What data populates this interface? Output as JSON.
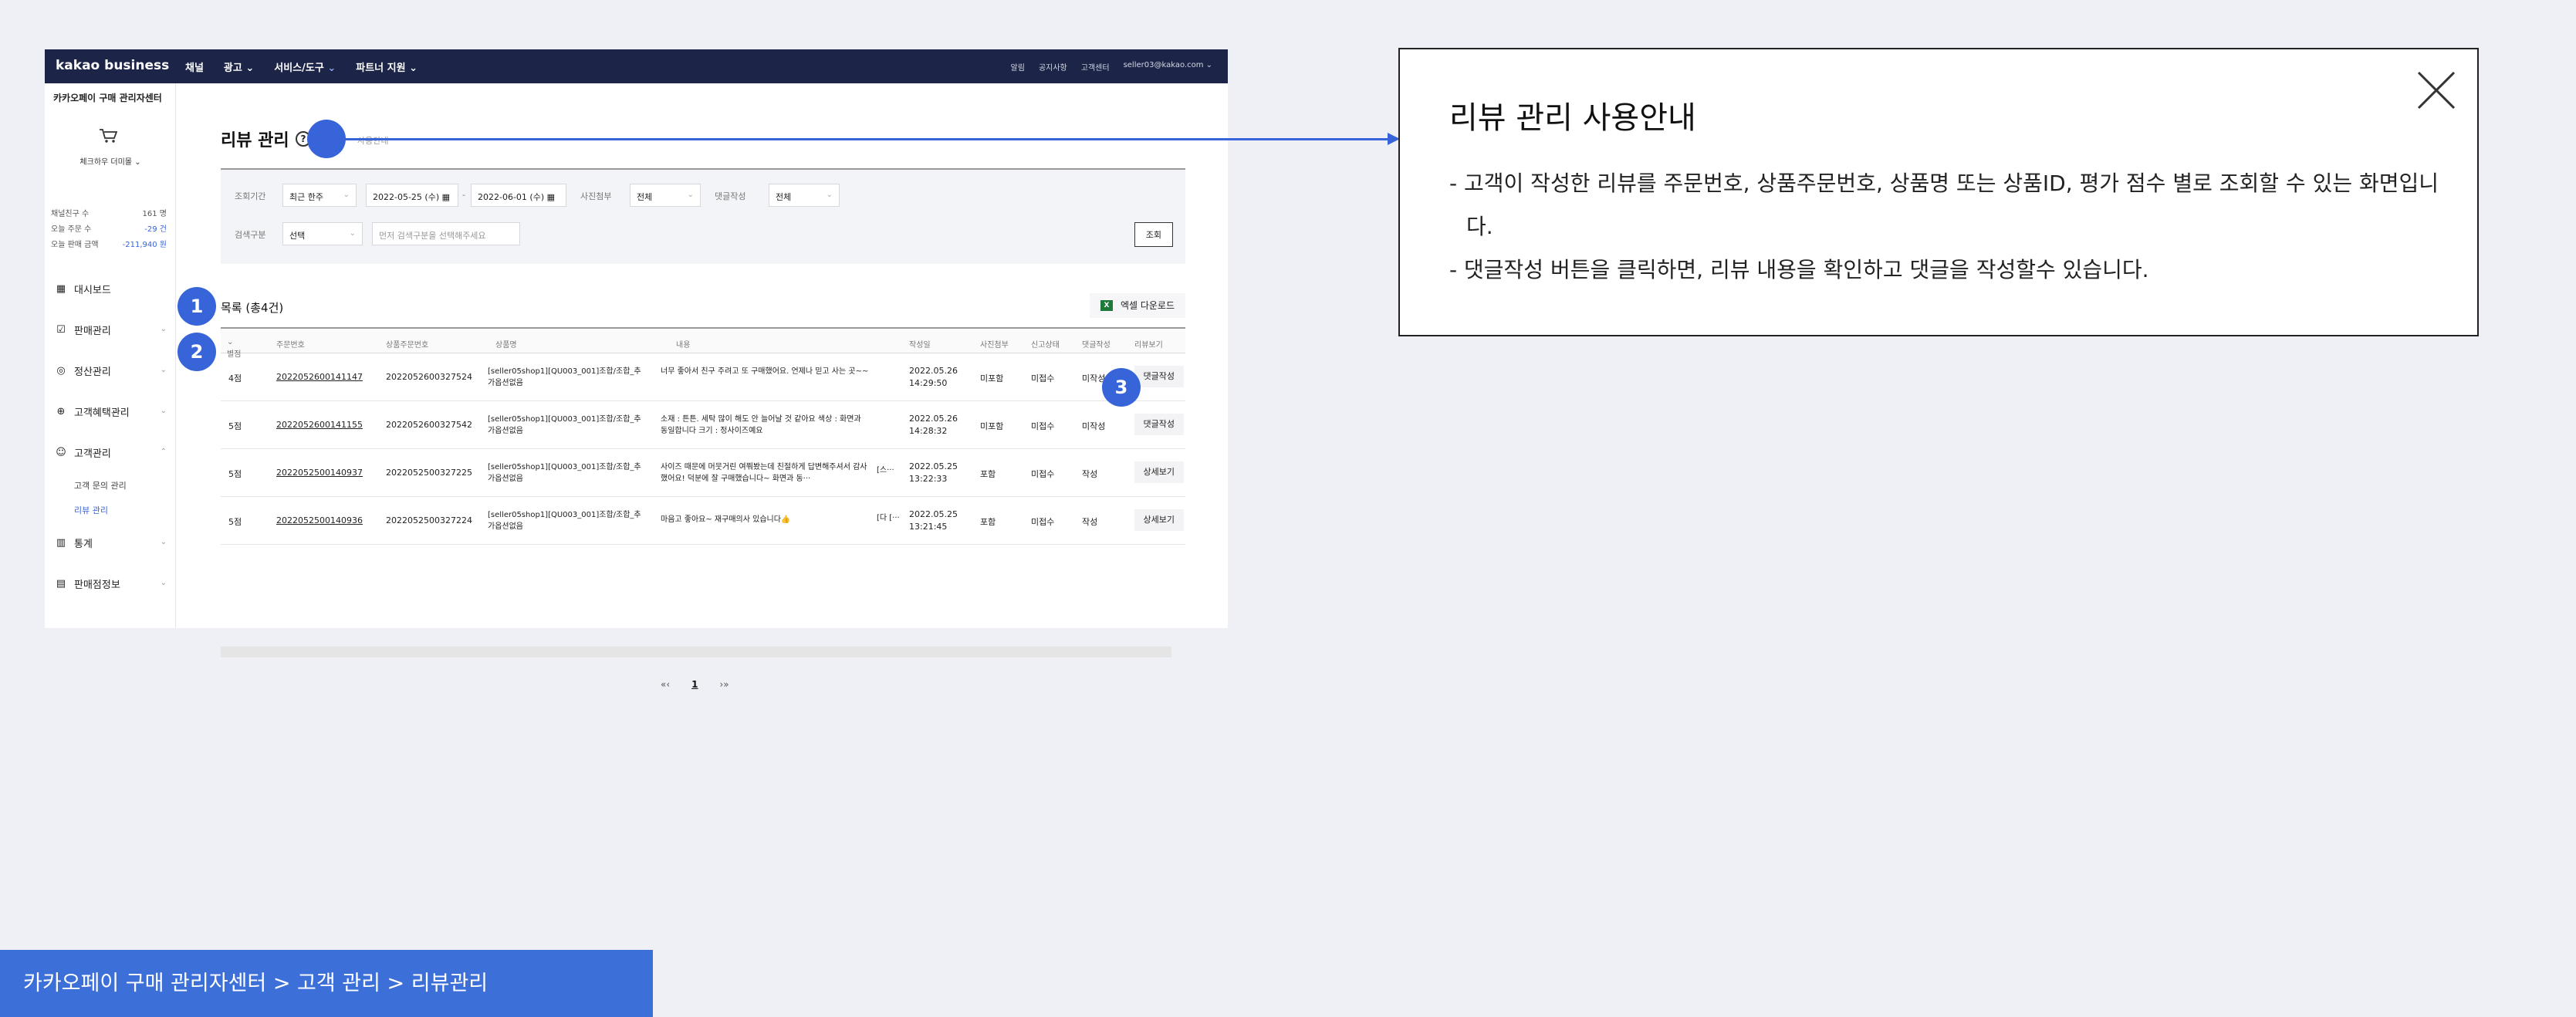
{
  "app": {
    "brand": "kakao business",
    "nav": [
      "채널",
      "광고",
      "서비스/도구",
      "파트너 지원"
    ],
    "util": [
      "알림",
      "공지사항",
      "고객센터",
      "seller03@kakao.com"
    ]
  },
  "sidebar": {
    "title": "카카오페이 구매 관리자센터",
    "store": "체크하우 더미몰",
    "stats": [
      {
        "label": "채널친구 수",
        "value": "161 명"
      },
      {
        "label": "오늘 주문 수",
        "value": "-29 건"
      },
      {
        "label": "오늘 판매 금액",
        "value": "-211,940 원"
      }
    ],
    "menu": [
      {
        "label": "대시보드"
      },
      {
        "label": "판매관리"
      },
      {
        "label": "정산관리"
      },
      {
        "label": "고객혜택관리"
      },
      {
        "label": "고객관리"
      },
      {
        "label": "통계"
      },
      {
        "label": "판매점정보"
      }
    ],
    "submenu": [
      "고객 문의 관리",
      "리뷰 관리"
    ]
  },
  "main": {
    "title": "리뷰 관리",
    "guide_link": "사용안내",
    "filter": {
      "period_label": "조회기간",
      "period_value": "최근 한주",
      "date_from": "2022-05-25 (수)",
      "date_sep": "-",
      "date_to": "2022-06-01 (수)",
      "photo_label": "사진첨부",
      "photo_value": "전체",
      "reply_label": "댓글작성",
      "reply_value": "전체",
      "search_label": "검색구분",
      "search_value": "선택",
      "search_placeholder": "먼저 검색구분을 선택해주세요",
      "search_button": "조회"
    },
    "list_title": "목록 (총4건)",
    "excel_label": "엑셀 다운로드",
    "columns": [
      "별점",
      "주문번호",
      "상품주문번호",
      "상품명",
      "내용",
      "작성일",
      "사진첨부",
      "신고상태",
      "댓글작성",
      "리뷰보기"
    ],
    "rows": [
      {
        "rating": "4점",
        "order": "2022052600141147",
        "item_order": "2022052600327524",
        "product": "[seller05shop1][QU003_001]조합/조합_추가옵션없음",
        "content": "너무 좋아서 친구 주려고 또 구매했어요. 언제나 믿고 사는 곳~~",
        "extra": "",
        "date": "2022.05.26",
        "time": "14:29:50",
        "photo": "미포함",
        "report": "미접수",
        "reply": "미작성",
        "action": "댓글작성"
      },
      {
        "rating": "5점",
        "order": "2022052600141155",
        "item_order": "2022052600327542",
        "product": "[seller05shop1][QU003_001]조합/조합_추가옵션없음",
        "content": "소재 : 튼튼. 세탁 많이 해도 안 늘어날 것 같아요 색상 : 화면과 동일합니다 크기 : 정사이즈예요",
        "extra": "",
        "date": "2022.05.26",
        "time": "14:28:32",
        "photo": "미포함",
        "report": "미접수",
        "reply": "미작성",
        "action": "댓글작성"
      },
      {
        "rating": "5점",
        "order": "2022052500140937",
        "item_order": "2022052500327225",
        "product": "[seller05shop1][QU003_001]조합/조합_추가옵션없음",
        "content": "사이즈 때문에 머뭇거린 여쭤봤는데 친절하게 답변해주셔서 감사했어요! 덕분에 잘 구매했습니다~ 화면과 동···",
        "extra": "[스···",
        "date": "2022.05.25",
        "time": "13:22:33",
        "photo": "포함",
        "report": "미접수",
        "reply": "작성",
        "action": "상세보기"
      },
      {
        "rating": "5점",
        "order": "2022052500140936",
        "item_order": "2022052500327224",
        "product": "[seller05shop1][QU003_001]조합/조합_추가옵션없음",
        "content": "마음고 좋아요~ 재구매의사 있습니다👍",
        "extra": "[다 [···",
        "date": "2022.05.25",
        "time": "13:21:45",
        "photo": "포함",
        "report": "미접수",
        "reply": "작성",
        "action": "상세보기"
      }
    ],
    "pagination": {
      "prev": "«‹",
      "current": "1",
      "next": "›»"
    }
  },
  "callouts": [
    "1",
    "2",
    "3"
  ],
  "guide": {
    "title": "리뷰 관리 사용안내",
    "lines": [
      "- 고객이 작성한 리뷰를 주문번호, 상품주문번호, 상품명 또는 상품ID, 평가 점수 별로 조회할 수 있는 화면입니다.",
      "- 댓글작성 버튼을 클릭하면, 리뷰 내용을 확인하고 댓글을 작성할수 있습니다."
    ]
  },
  "breadcrumb": "카카오페이 구매 관리자센터 > 고객 관리 > 리뷰관리",
  "colors": {
    "accent": "#3764d8",
    "topbar": "#1c2447",
    "breadcrumb_bg": "#3c6fd8"
  }
}
